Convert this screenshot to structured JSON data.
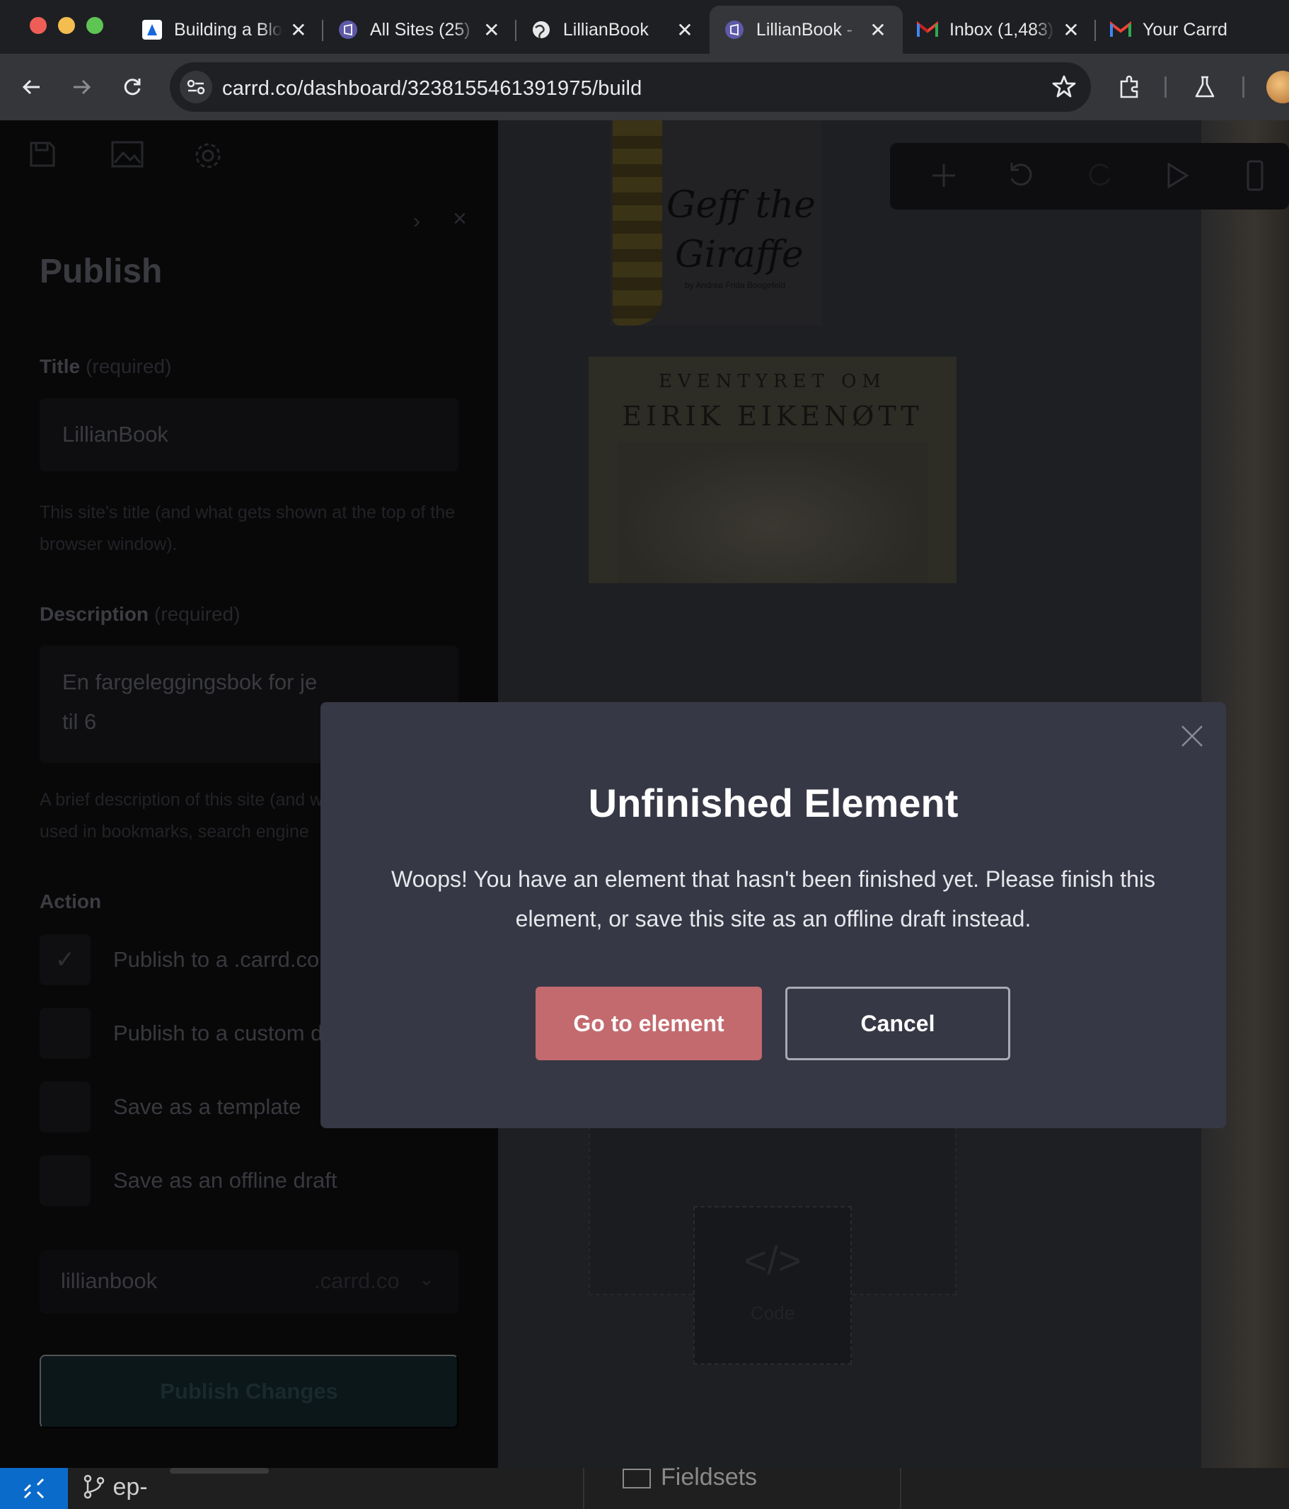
{
  "browser": {
    "tabs": [
      {
        "label": "Building a Blo",
        "icon": "atlassian-icon",
        "active": false
      },
      {
        "label": "All Sites (25)",
        "icon": "carrd-icon",
        "active": false
      },
      {
        "label": "LillianBook",
        "icon": "globe-icon",
        "active": false
      },
      {
        "label": "LillianBook - ",
        "icon": "carrd-icon",
        "active": true
      },
      {
        "label": "Inbox (1,483)",
        "icon": "gmail-icon",
        "active": false
      },
      {
        "label": "Your Carrd",
        "icon": "gmail-icon",
        "active": false
      }
    ],
    "url": "carrd.co/dashboard/3238155461391975/build"
  },
  "panel": {
    "title": "Publish",
    "title_field": {
      "label": "Title",
      "required": "(required)",
      "value": "LillianBook",
      "hint": "This site's title (and what gets shown at the top of the browser window)."
    },
    "description_field": {
      "label": "Description",
      "required": "(required)",
      "value_line1": "En fargeleggingsbok for je",
      "value_line2": "til 6",
      "hint_line1": "A brief description of this site (and w",
      "hint_line2": "used in bookmarks, search engine"
    },
    "action_label": "Action",
    "actions": [
      {
        "label": "Publish to a .carrd.co",
        "checked": true
      },
      {
        "label": "Publish to a custom domain",
        "checked": false
      },
      {
        "label": "Save as a template",
        "checked": false
      },
      {
        "label": "Save as an offline draft",
        "checked": false
      }
    ],
    "domain": {
      "subdomain": "lillianbook",
      "tld": ".carrd.co"
    },
    "publish_button": "Publish Changes"
  },
  "canvas": {
    "book1_title_line1": "Geff the",
    "book1_title_line2": "Giraffe",
    "book1_author": "by Andrea Frida Boogefeld",
    "book2_line1": "EVENTYRET OM",
    "book2_line2": "EIRIK EIKENØTT",
    "code_label": "Code"
  },
  "modal": {
    "title": "Unfinished Element",
    "body": "Woops! You have an element that hasn't been finished yet. Please finish this element, or save this site as an offline draft instead.",
    "primary_button": "Go to element",
    "secondary_button": "Cancel",
    "colors": {
      "background": "#373845",
      "primary": "#c36a6e"
    }
  },
  "taskbar": {
    "branch": "ep-",
    "panel_label": "Fieldsets"
  }
}
